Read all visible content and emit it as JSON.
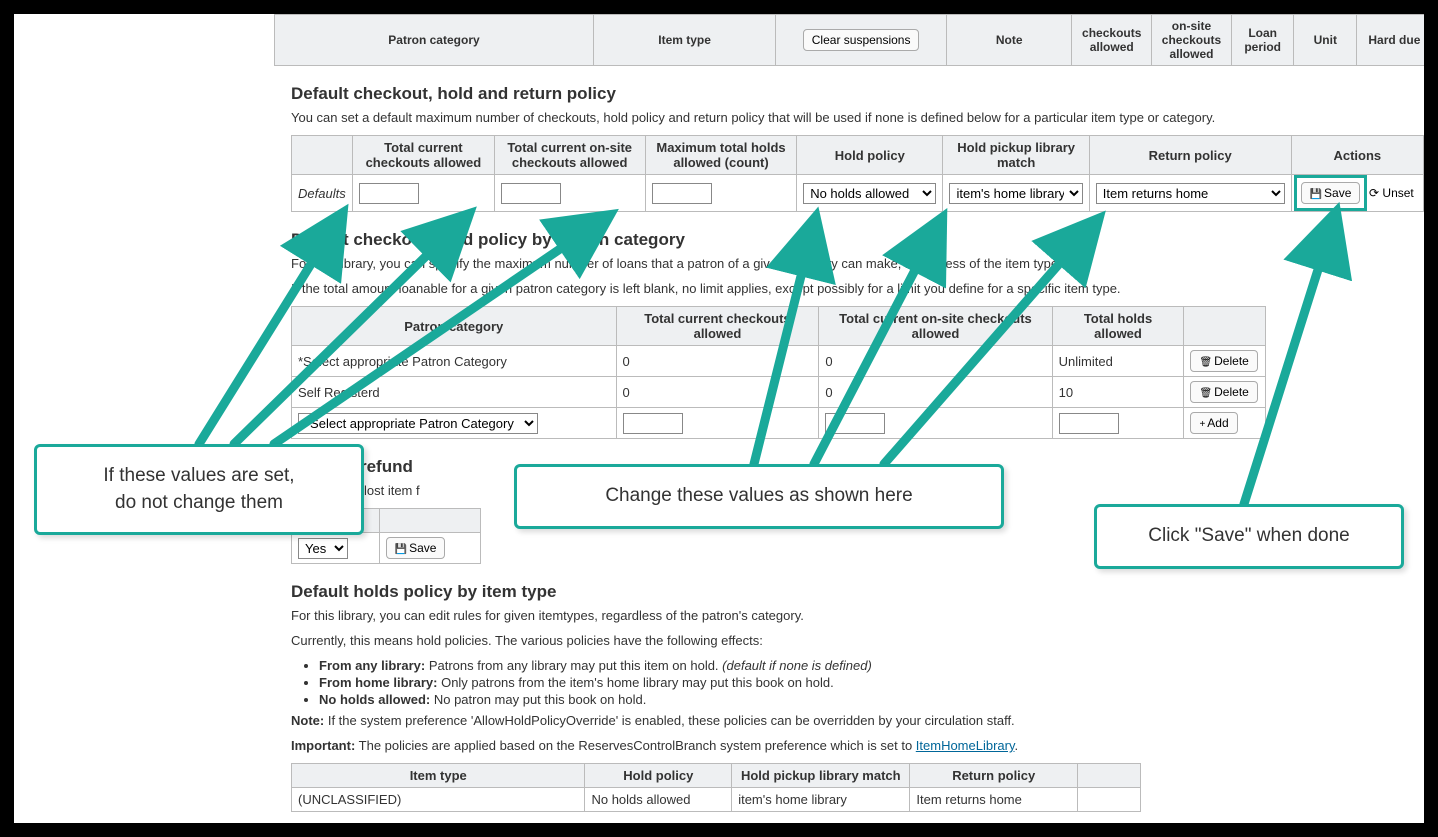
{
  "topTable": {
    "headers": [
      "Patron category",
      "Item type",
      "",
      "Note",
      "checkouts allowed",
      "on-site checkouts allowed",
      "Loan period",
      "Unit",
      "Hard due dat"
    ],
    "clearBtn": "Clear suspensions"
  },
  "section1": {
    "title": "Default checkout, hold and return policy",
    "desc": "You can set a default maximum number of checkouts, hold policy and return policy that will be used if none is defined below for a particular item type or category.",
    "headers": [
      "",
      "Total current checkouts allowed",
      "Total current on-site checkouts allowed",
      "Maximum total holds allowed (count)",
      "Hold policy",
      "Hold pickup library match",
      "Return policy",
      "Actions"
    ],
    "row": {
      "label": "Defaults",
      "holdPolicy": "No holds allowed",
      "pickupMatch": "item's home library",
      "returnPolicy": "Item returns home",
      "saveBtn": "Save",
      "unsetBtn": "Unset"
    }
  },
  "section2": {
    "title": "Default checkout, hold policy by patron category",
    "desc1": "For this library, you can specify the maximum number of loans that a patron of a given category can make, regardless of the item type.",
    "desc2": "If the total amount loanable for a given patron category is left blank, no limit applies, except possibly for a limit you define for a specific item type.",
    "headers": [
      "Patron category",
      "Total current checkouts allowed",
      "Total current on-site checkouts allowed",
      "Total holds allowed",
      ""
    ],
    "rows": [
      {
        "cat": "*Select appropriate Patron Category",
        "cur": "0",
        "onsite": "0",
        "holds": "Unlimited",
        "btn": "Delete",
        "icon": "🗑"
      },
      {
        "cat": "Self Registerd",
        "cur": "0",
        "onsite": "0",
        "holds": "10",
        "btn": "Delete",
        "icon": "🗑"
      }
    ],
    "addRow": {
      "cat": "*Select appropriate Patron Category",
      "btn": "Add",
      "icon": "+"
    }
  },
  "section3": {
    "title": "item fee refund",
    "desc": "ult policy for lost item f",
    "feeLabel": "em fee",
    "saveBtn": "Save"
  },
  "section4": {
    "title": "Default holds policy by item type",
    "desc1": "For this library, you can edit rules for given itemtypes, regardless of the patron's category.",
    "desc2": "Currently, this means hold policies. The various policies have the following effects:",
    "bullets": [
      {
        "b": "From any library:",
        "t": " Patrons from any library may put this item on hold. ",
        "i": "(default if none is defined)"
      },
      {
        "b": "From home library:",
        "t": " Only patrons from the item's home library may put this book on hold.",
        "i": ""
      },
      {
        "b": "No holds allowed:",
        "t": " No patron may put this book on hold.",
        "i": ""
      }
    ],
    "note": "Note:",
    "noteText": " If the system preference 'AllowHoldPolicyOverride' is enabled, these policies can be overridden by your circulation staff.",
    "imp": "Important:",
    "impText": " The policies are applied based on the ReservesControlBranch system preference which is set to ",
    "impLink": "ItemHomeLibrary",
    "headers": [
      "Item type",
      "Hold policy",
      "Hold pickup library match",
      "Return policy",
      ""
    ],
    "row": {
      "type": "(UNCLASSIFIED)",
      "hold": "No holds allowed",
      "pickup": "item's home library",
      "ret": "Item returns home"
    }
  },
  "callouts": {
    "left": "If these values are set,\ndo not change them",
    "mid": "Change these values as shown here",
    "right": "Click \"Save\" when done"
  }
}
